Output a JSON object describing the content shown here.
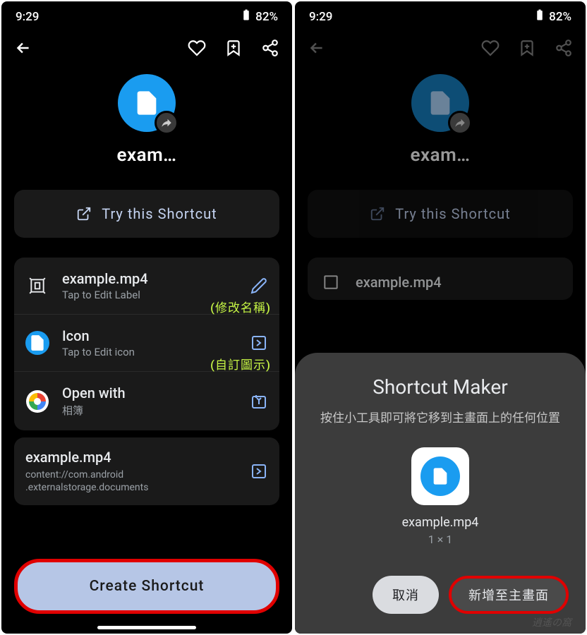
{
  "status": {
    "time": "9:29",
    "battery": "82%"
  },
  "hero": {
    "title": "exam…"
  },
  "try_button": "Try this Shortcut",
  "items": {
    "label": {
      "title": "example.mp4",
      "sub": "Tap to Edit Label",
      "annotation": "(修改名稱)"
    },
    "icon": {
      "title": "Icon",
      "sub": "Tap to Edit icon",
      "annotation": "(自訂圖示)"
    },
    "open": {
      "title": "Open with",
      "sub": "相簿"
    }
  },
  "uri": {
    "title": "example.mp4",
    "sub": "content://com.android\n.externalstorage.documents"
  },
  "create_button": "Create Shortcut",
  "dialog": {
    "title": "Shortcut Maker",
    "desc": "按住小工具即可將它移到主畫面上的任何位置",
    "name": "example.mp4",
    "size": "1 × 1",
    "cancel": "取消",
    "add": "新增至主畫面"
  },
  "watermark": "逍遙の窩"
}
